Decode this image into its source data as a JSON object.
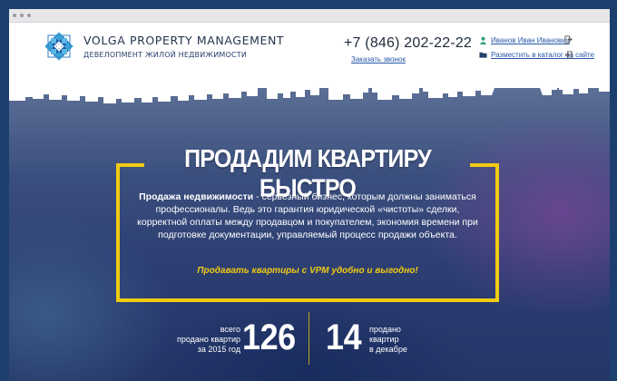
{
  "brand": {
    "name": "VOLGA PROPERTY MANAGEMENT",
    "tagline": "ДЕВЕЛОПМЕНТ ЖИЛОЙ НЕДВИЖИМОСТИ"
  },
  "contact": {
    "phone": "+7 (846) 202-22-22",
    "callback_label": "Заказать звонок"
  },
  "account": {
    "user_name": "Иванов Иван Иванович",
    "catalog_link": "Разместить в каталог на сайте"
  },
  "hero": {
    "title": "ПРОДАДИМ КВАРТИРУ БЫСТРО",
    "body_bold": "Продажа недвижимости",
    "body_rest": " - серьезный бизнес, которым должны заниматься профессионалы. Ведь это гарантия юридической «чистоты» сделки, корректной оплаты между продавцом и покупателем, экономия времени при подготовке документации, управляемый процесс продажи объекта.",
    "cta": "Продавать квартиры с VPM удобно и выгодно!"
  },
  "stats": {
    "total_label_line1": "всего",
    "total_label_line2": "продано квартир",
    "total_label_line3": "за 2015 год",
    "total_value": "126",
    "month_value": "14",
    "month_label_line1": "продано",
    "month_label_line2": "квартир",
    "month_label_line3": "в декабре"
  },
  "icons": {
    "user": "user-icon",
    "catalog": "folder-icon",
    "exit": "exit-icon",
    "login": "login-icon"
  },
  "colors": {
    "accent": "#f0cb12",
    "link": "#2858a8",
    "hero_bg": "#2c3e72"
  }
}
